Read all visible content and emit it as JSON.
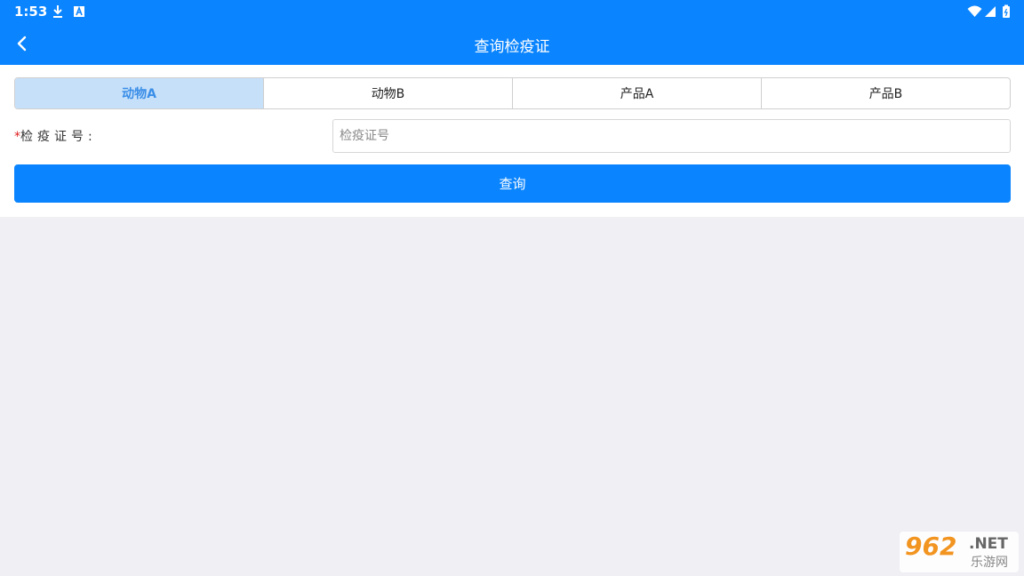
{
  "status_bar": {
    "time": "1:53",
    "icons": [
      "download-icon",
      "a-badge-icon",
      "wifi-icon",
      "signal-icon",
      "battery-icon"
    ]
  },
  "app_bar": {
    "title": "查询检疫证",
    "back_icon": "chevron-left-icon"
  },
  "tabs": [
    {
      "label": "动物A",
      "active": true
    },
    {
      "label": "动物B",
      "active": false
    },
    {
      "label": "产品A",
      "active": false
    },
    {
      "label": "产品B",
      "active": false
    }
  ],
  "form": {
    "required_mark": "*",
    "label": "检疫证号:",
    "input_value": "",
    "input_placeholder": "检疫证号"
  },
  "query_button": {
    "label": "查询"
  },
  "watermark": {
    "brand": "962",
    "suffix": ".NET",
    "sub": "乐游网"
  },
  "colors": {
    "primary": "#0a84ff",
    "tab_active_bg": "#c7e0f9",
    "tab_active_text": "#3a8ee8",
    "page_bg": "#efeff4",
    "required": "#e02020"
  }
}
